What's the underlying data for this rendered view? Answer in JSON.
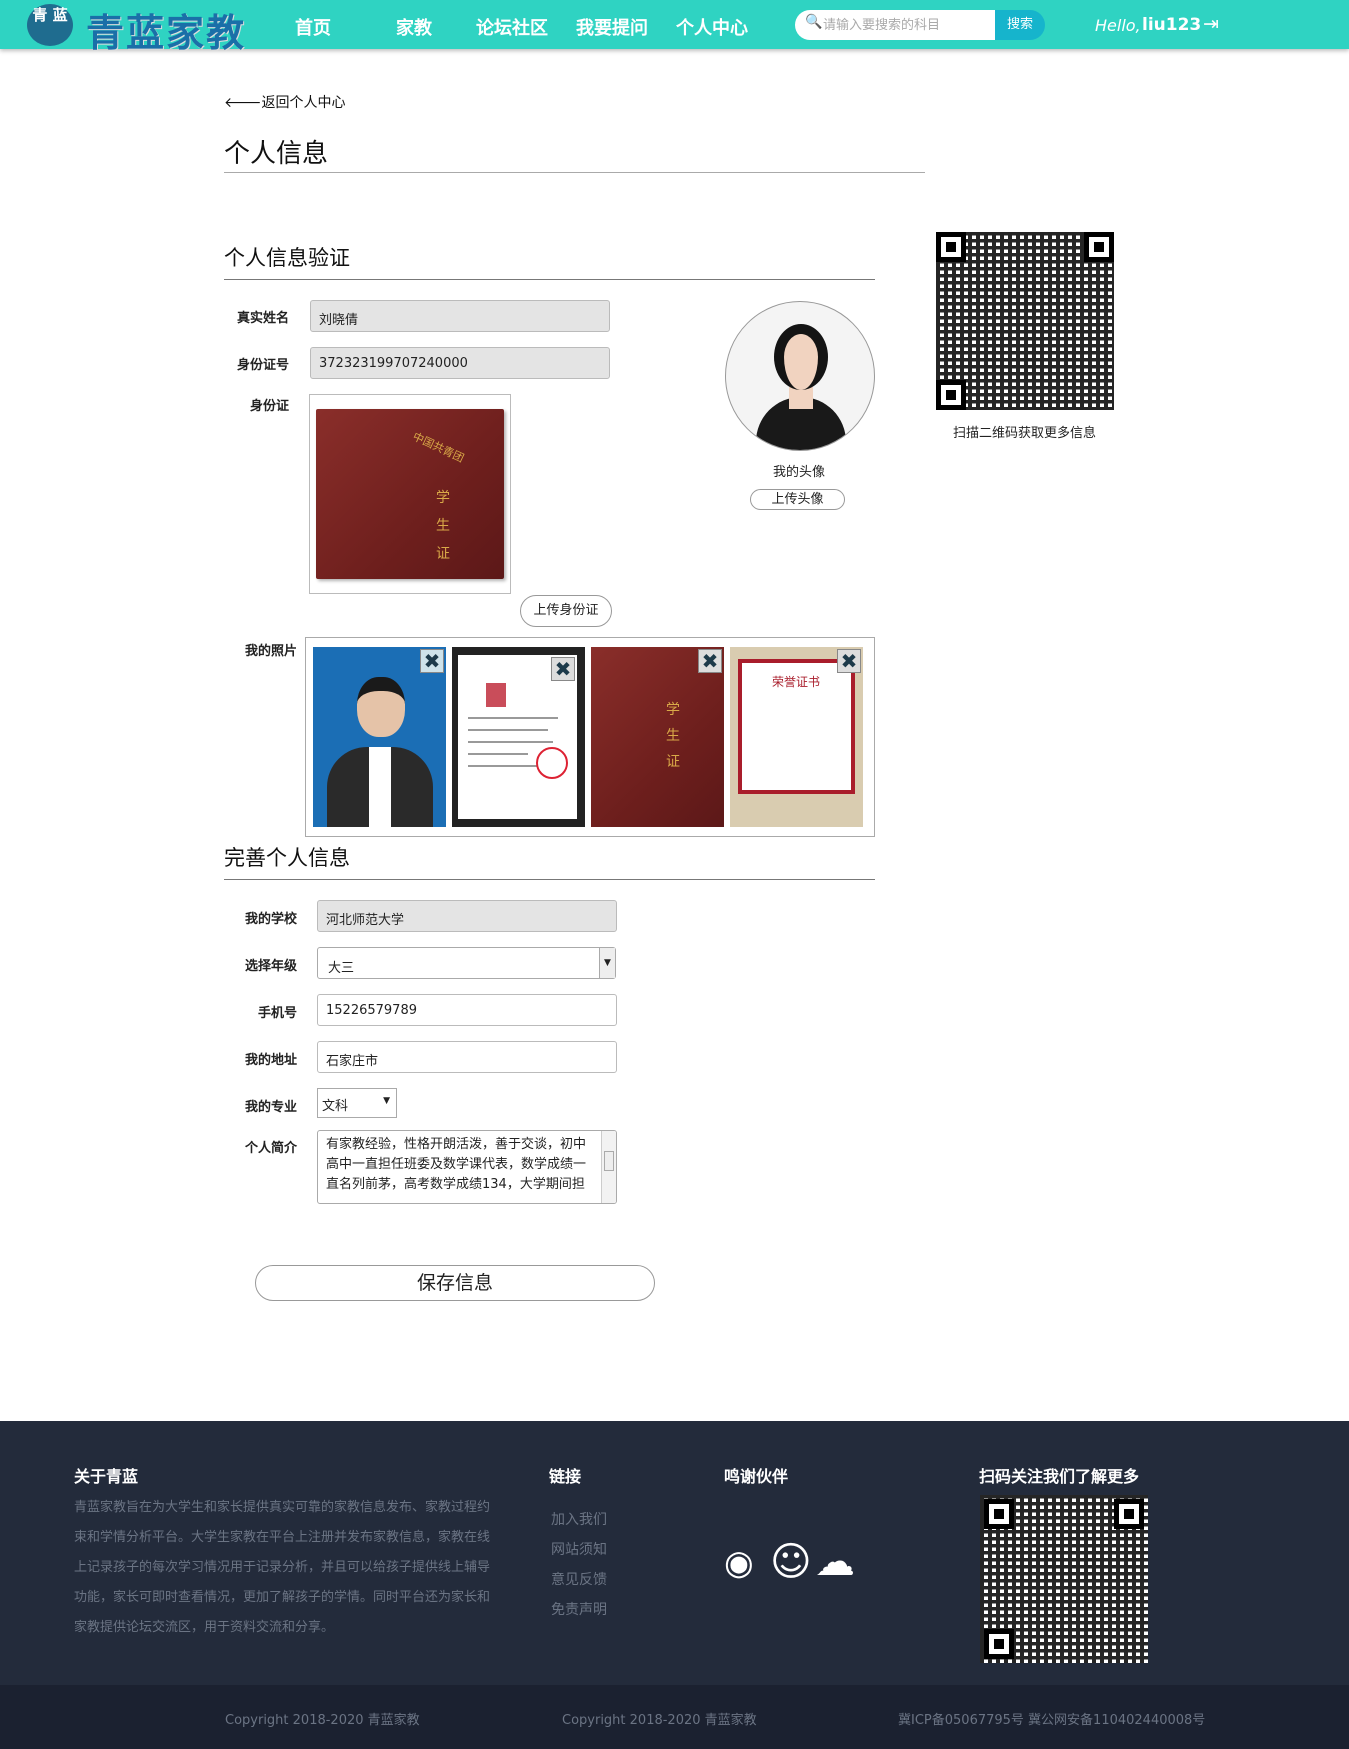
{
  "nav": {
    "logo_seal": "青 蓝",
    "logo_text": "青蓝家教",
    "items": [
      "首页",
      "家教",
      "论坛社区",
      "我要提问",
      "个人中心"
    ],
    "search_placeholder": "请输入要搜索的科目",
    "search_button": "搜索",
    "hello": "Hello,",
    "username": "liu123"
  },
  "page": {
    "back_link": "🡐返回个人中心",
    "title": "个人信息"
  },
  "verify": {
    "section_title": "个人信息验证",
    "real_name_label": "真实姓名",
    "real_name": "刘晓倩",
    "id_label": "身份证号",
    "id_number": "372323199707240000",
    "id_card_label": "身份证",
    "upload_id_button": "上传身份证",
    "photos_label": "我的照片",
    "avatar_caption": "我的头像",
    "upload_avatar_button": "上传头像",
    "qr_caption": "扫描二维码获取更多信息"
  },
  "profile": {
    "section_title": "完善个人信息",
    "school_label": "我的学校",
    "school": "河北师范大学",
    "grade_label": "选择年级",
    "grade": "大三",
    "phone_label": "手机号",
    "phone": "15226579789",
    "address_label": "我的地址",
    "address": "石家庄市",
    "major_label": "我的专业",
    "major": "文科",
    "intro_label": "个人简介",
    "intro": "有家教经验，性格开朗活泼，善于交谈，初中高中一直担任班委及数学课代表，数学成绩一直名列前茅，高考数学成绩134，大学期间担",
    "save_button": "保存信息"
  },
  "footer": {
    "about_title": "关于青蓝",
    "about_text": "青蓝家教旨在为大学生和家长提供真实可靠的家教信息发布、家教过程约束和学情分析平台。大学生家教在平台上注册并发布家教信息，家教在线上记录孩子的每次学习情况用于记录分析，并且可以给孩子提供线上辅导功能，家长可即时查看情况，更加了解孩子的学情。同时平台还为家长和家教提供论坛交流区，用于资料交流和分享。",
    "links_title": "链接",
    "links": [
      "加入我们",
      "网站须知",
      "意见反馈",
      "免责声明"
    ],
    "partners_title": "鸣谢伙伴",
    "qr_title": "扫码关注我们了解更多",
    "copyright1": "Copyright 2018-2020   青蓝家教",
    "copyright2": "Copyright 2018-2020   青蓝家教",
    "icp": "冀ICP备05067795号 冀公网安备110402440008号"
  },
  "icons": {
    "search": "🔍",
    "logout": "⇥",
    "delete": "✖",
    "github": "◉",
    "qq": "☺",
    "wechat": "☁"
  },
  "colors": {
    "nav_bg": "#2fd3c2",
    "search_btn": "#16b4cc",
    "footer_bg": "#232b3b",
    "bottom_bg": "#1b2130"
  }
}
